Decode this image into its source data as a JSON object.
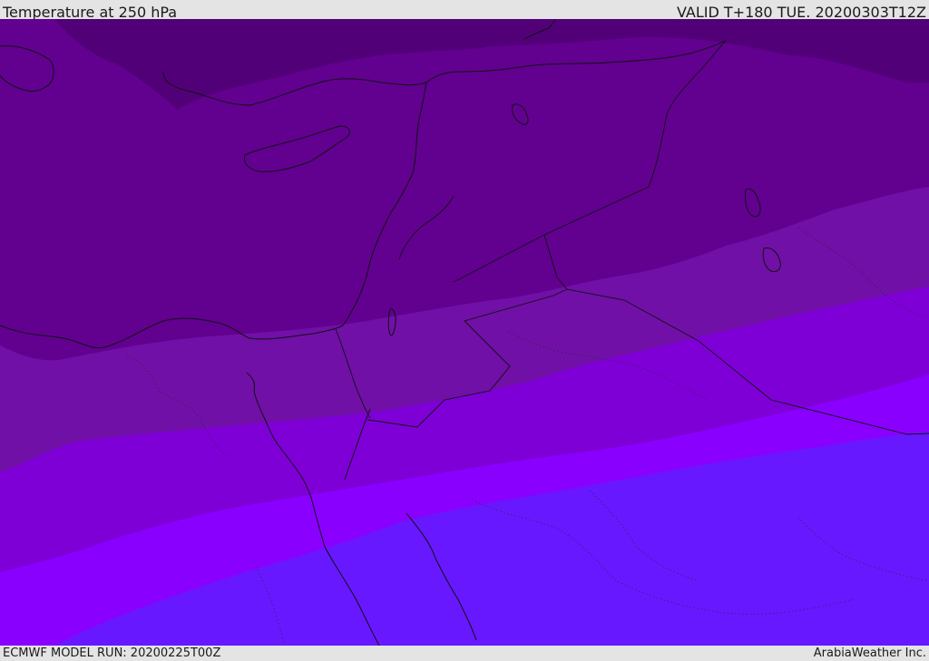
{
  "header": {
    "title": "Temperature at 250 hPa",
    "valid": "VALID T+180 TUE. 20200303T12Z"
  },
  "footer": {
    "model_run": "ECMWF MODEL RUN: 20200225T00Z",
    "credit": "ArabiaWeather Inc."
  },
  "map": {
    "field": "temperature",
    "level": "250 hPa",
    "region": "Eastern Mediterranean / Middle East",
    "shading_colors": [
      "#520078",
      "#620090",
      "#7010a6",
      "#7e00d6",
      "#8a00ff",
      "#6718ff"
    ]
  }
}
